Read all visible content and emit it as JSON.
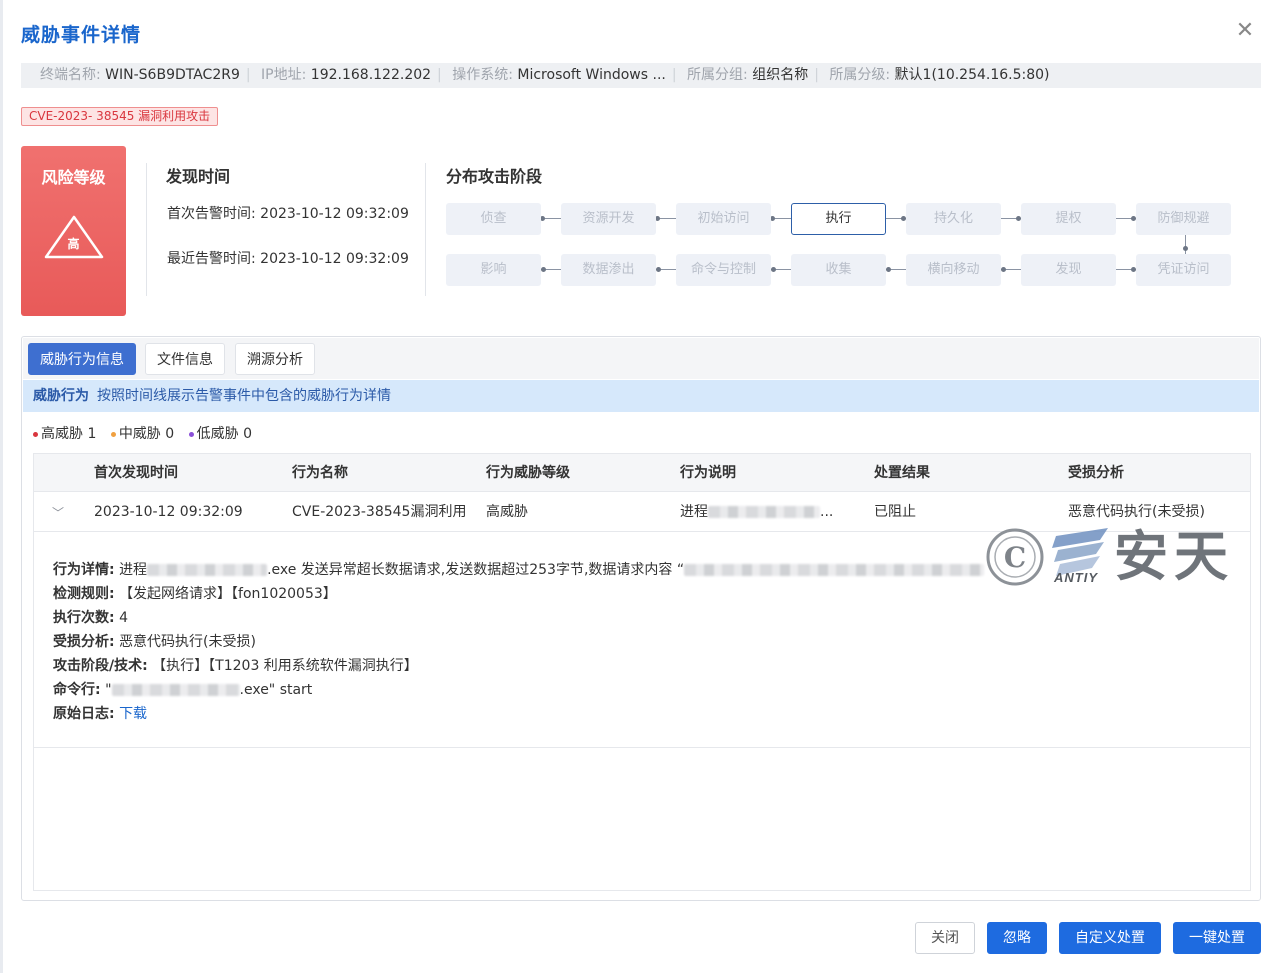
{
  "dialog": {
    "title": "威胁事件详情"
  },
  "info": [
    {
      "label": "终端名称:",
      "value": "WIN-S6B9DTAC2R9"
    },
    {
      "label": "IP地址:",
      "value": "192.168.122.202"
    },
    {
      "label": "操作系统:",
      "value": "Microsoft Windows ..."
    },
    {
      "label": "所属分组:",
      "value": "组织名称"
    },
    {
      "label": "所属分级:",
      "value": "默认1(10.254.16.5:80)"
    }
  ],
  "tag": "CVE-2023- 38545 漏洞利用攻击",
  "risk": {
    "title": "风险等级",
    "level": "高"
  },
  "discovery": {
    "title": "发现时间",
    "first": "首次告警时间:  2023-10-12 09:32:09",
    "latest": "最近告警时间:  2023-10-12 09:32:09"
  },
  "stages": {
    "title": "分布攻击阶段",
    "row1": [
      "侦查",
      "资源开发",
      "初始访问",
      "执行",
      "持久化",
      "提权",
      "防御规避"
    ],
    "row2": [
      "影响",
      "数据渗出",
      "命令与控制",
      "收集",
      "横向移动",
      "发现",
      "凭证访问"
    ],
    "active": "执行"
  },
  "tabs": [
    "威胁行为信息",
    "文件信息",
    "溯源分析"
  ],
  "banner": {
    "title": "威胁行为",
    "text": "按照时间线展示告警事件中包含的威胁行为详情"
  },
  "legend": [
    {
      "label": "高威胁 1",
      "color": "#d9363e"
    },
    {
      "label": "中威胁 0",
      "color": "#f0a040"
    },
    {
      "label": "低威胁 0",
      "color": "#8a4fd8"
    }
  ],
  "table": {
    "columns": [
      "首次发现时间",
      "行为名称",
      "行为威胁等级",
      "行为说明",
      "处置结果",
      "受损分析"
    ],
    "row": {
      "time": "2023-10-12 09:32:09",
      "name": "CVE-2023-38545漏洞利用",
      "level": "高威胁",
      "desc_prefix": "进程",
      "desc_suffix": "...",
      "result": "已阻止",
      "damage": "恶意代码执行(未受损)"
    }
  },
  "detail": {
    "behavior_label": "行为详情:",
    "behavior_a": "进程",
    "behavior_b": ".exe 发送异常超长数据请求,发送数据超过253字节,数据请求内容 “",
    "rule_label": "检测规则:",
    "rule": "【发起网络请求】【fon1020053】",
    "count_label": "执行次数:",
    "count": "4",
    "damage_label": "受损分析:",
    "damage": "恶意代码执行(未受损)",
    "technique_label": "攻击阶段/技术:",
    "technique": "【执行】【T1203 利用系统软件漏洞执行】",
    "cmd_label": "命令行:",
    "cmd_a": "\"",
    "cmd_b": ".exe\" start",
    "log_label": "原始日志:",
    "log_link": "下载"
  },
  "watermark": {
    "brand": "安天",
    "latin": "ANTIY"
  },
  "buttons": {
    "close": "关闭",
    "ignore": "忽略",
    "custom": "自定义处置",
    "oneclick": "一键处置"
  }
}
